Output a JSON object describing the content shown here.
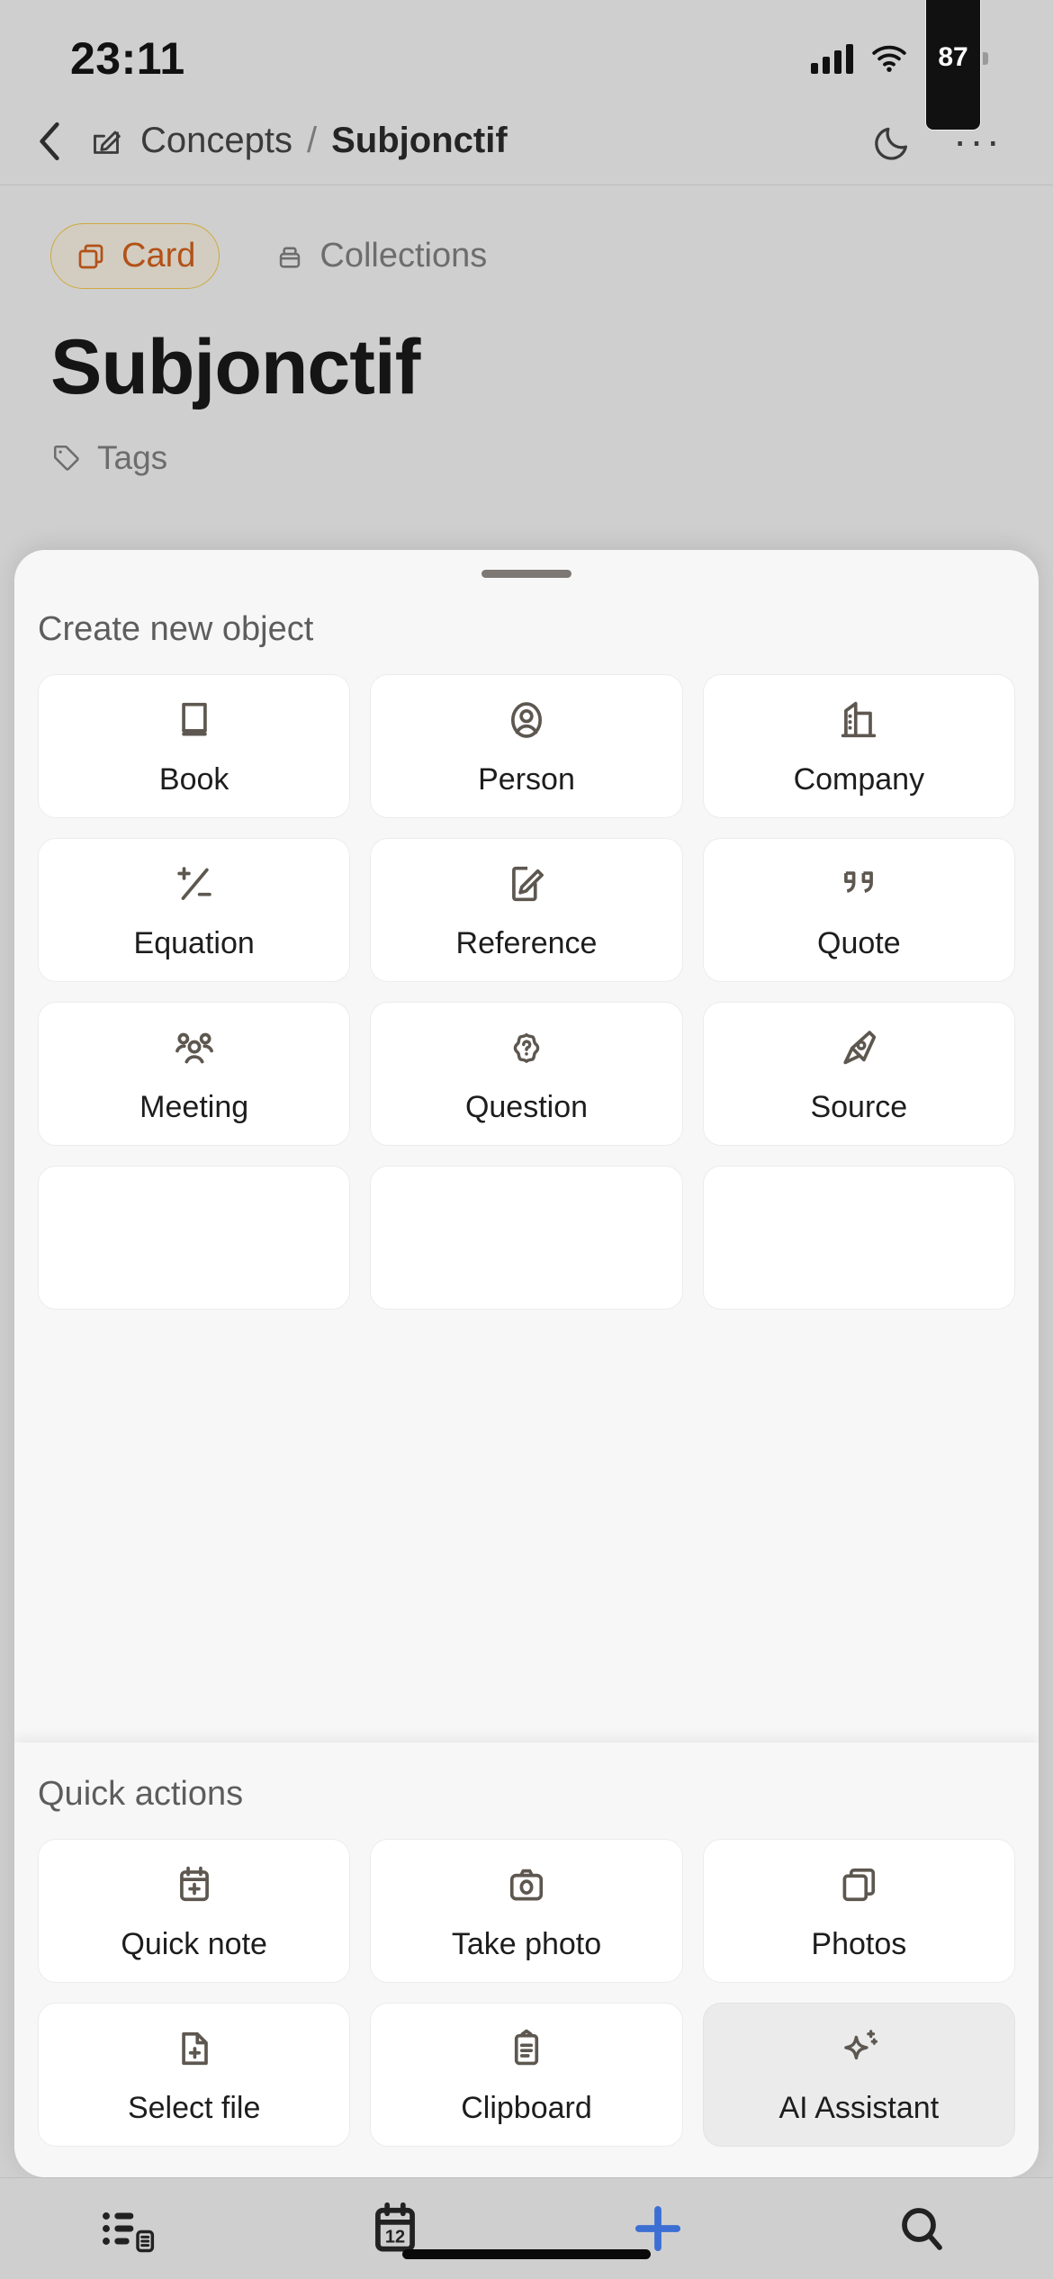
{
  "status_bar": {
    "time": "23:11",
    "signal_icon": "cellular-signal-icon",
    "wifi_icon": "wifi-icon",
    "battery_level": "87",
    "battery_icon": "battery-icon"
  },
  "nav_bar": {
    "back_icon": "chevron-left-icon",
    "edit_icon": "edit-square-icon",
    "breadcrumb_parent": "Concepts",
    "breadcrumb_separator": "/",
    "breadcrumb_current": "Subjonctif",
    "dark_mode_icon": "moon-icon",
    "more_icon": "ellipsis-icon",
    "more_label": "···"
  },
  "page": {
    "tabs": [
      {
        "label": "Card",
        "icon": "cards-stack-icon",
        "active": true
      },
      {
        "label": "Collections",
        "icon": "archive-box-icon",
        "active": false
      }
    ],
    "title": "Subjonctif",
    "tags_label": "Tags",
    "tags_icon": "tag-icon"
  },
  "sheet": {
    "grabber": "drag-handle",
    "objects": {
      "section_title": "Create new object",
      "items": [
        {
          "label": "Book",
          "icon": "book-icon"
        },
        {
          "label": "Person",
          "icon": "person-circle-icon"
        },
        {
          "label": "Company",
          "icon": "buildings-icon"
        },
        {
          "label": "Equation",
          "icon": "plus-minus-icon"
        },
        {
          "label": "Reference",
          "icon": "note-pencil-icon"
        },
        {
          "label": "Quote",
          "icon": "quotes-icon"
        },
        {
          "label": "Meeting",
          "icon": "users-three-icon"
        },
        {
          "label": "Question",
          "icon": "question-badge-icon"
        },
        {
          "label": "Source",
          "icon": "pen-nib-icon"
        }
      ]
    },
    "quick_actions": {
      "section_title": "Quick actions",
      "items": [
        {
          "label": "Quick note",
          "icon": "calendar-plus-icon",
          "pressed": false
        },
        {
          "label": "Take photo",
          "icon": "camera-icon",
          "pressed": false
        },
        {
          "label": "Photos",
          "icon": "images-stack-icon",
          "pressed": false
        },
        {
          "label": "Select file",
          "icon": "file-plus-icon",
          "pressed": false
        },
        {
          "label": "Clipboard",
          "icon": "clipboard-icon",
          "pressed": false
        },
        {
          "label": "AI Assistant",
          "icon": "sparkle-icon",
          "pressed": true
        }
      ]
    }
  },
  "tab_bar": {
    "items": [
      {
        "name": "list-view",
        "icon": "list-detail-icon"
      },
      {
        "name": "calendar",
        "icon": "calendar-icon",
        "day": "12"
      },
      {
        "name": "create",
        "icon": "plus-icon"
      },
      {
        "name": "search",
        "icon": "search-icon"
      }
    ],
    "accent_color": "#3b6fd4"
  },
  "colors": {
    "background": "#cfcfcf",
    "sheet": "#f7f7f7",
    "card": "#ffffff",
    "active_tab_text": "#b35118",
    "active_tab_bg": "#d2cdc0",
    "active_tab_border": "#cfa93f",
    "accent": "#3b6fd4"
  }
}
